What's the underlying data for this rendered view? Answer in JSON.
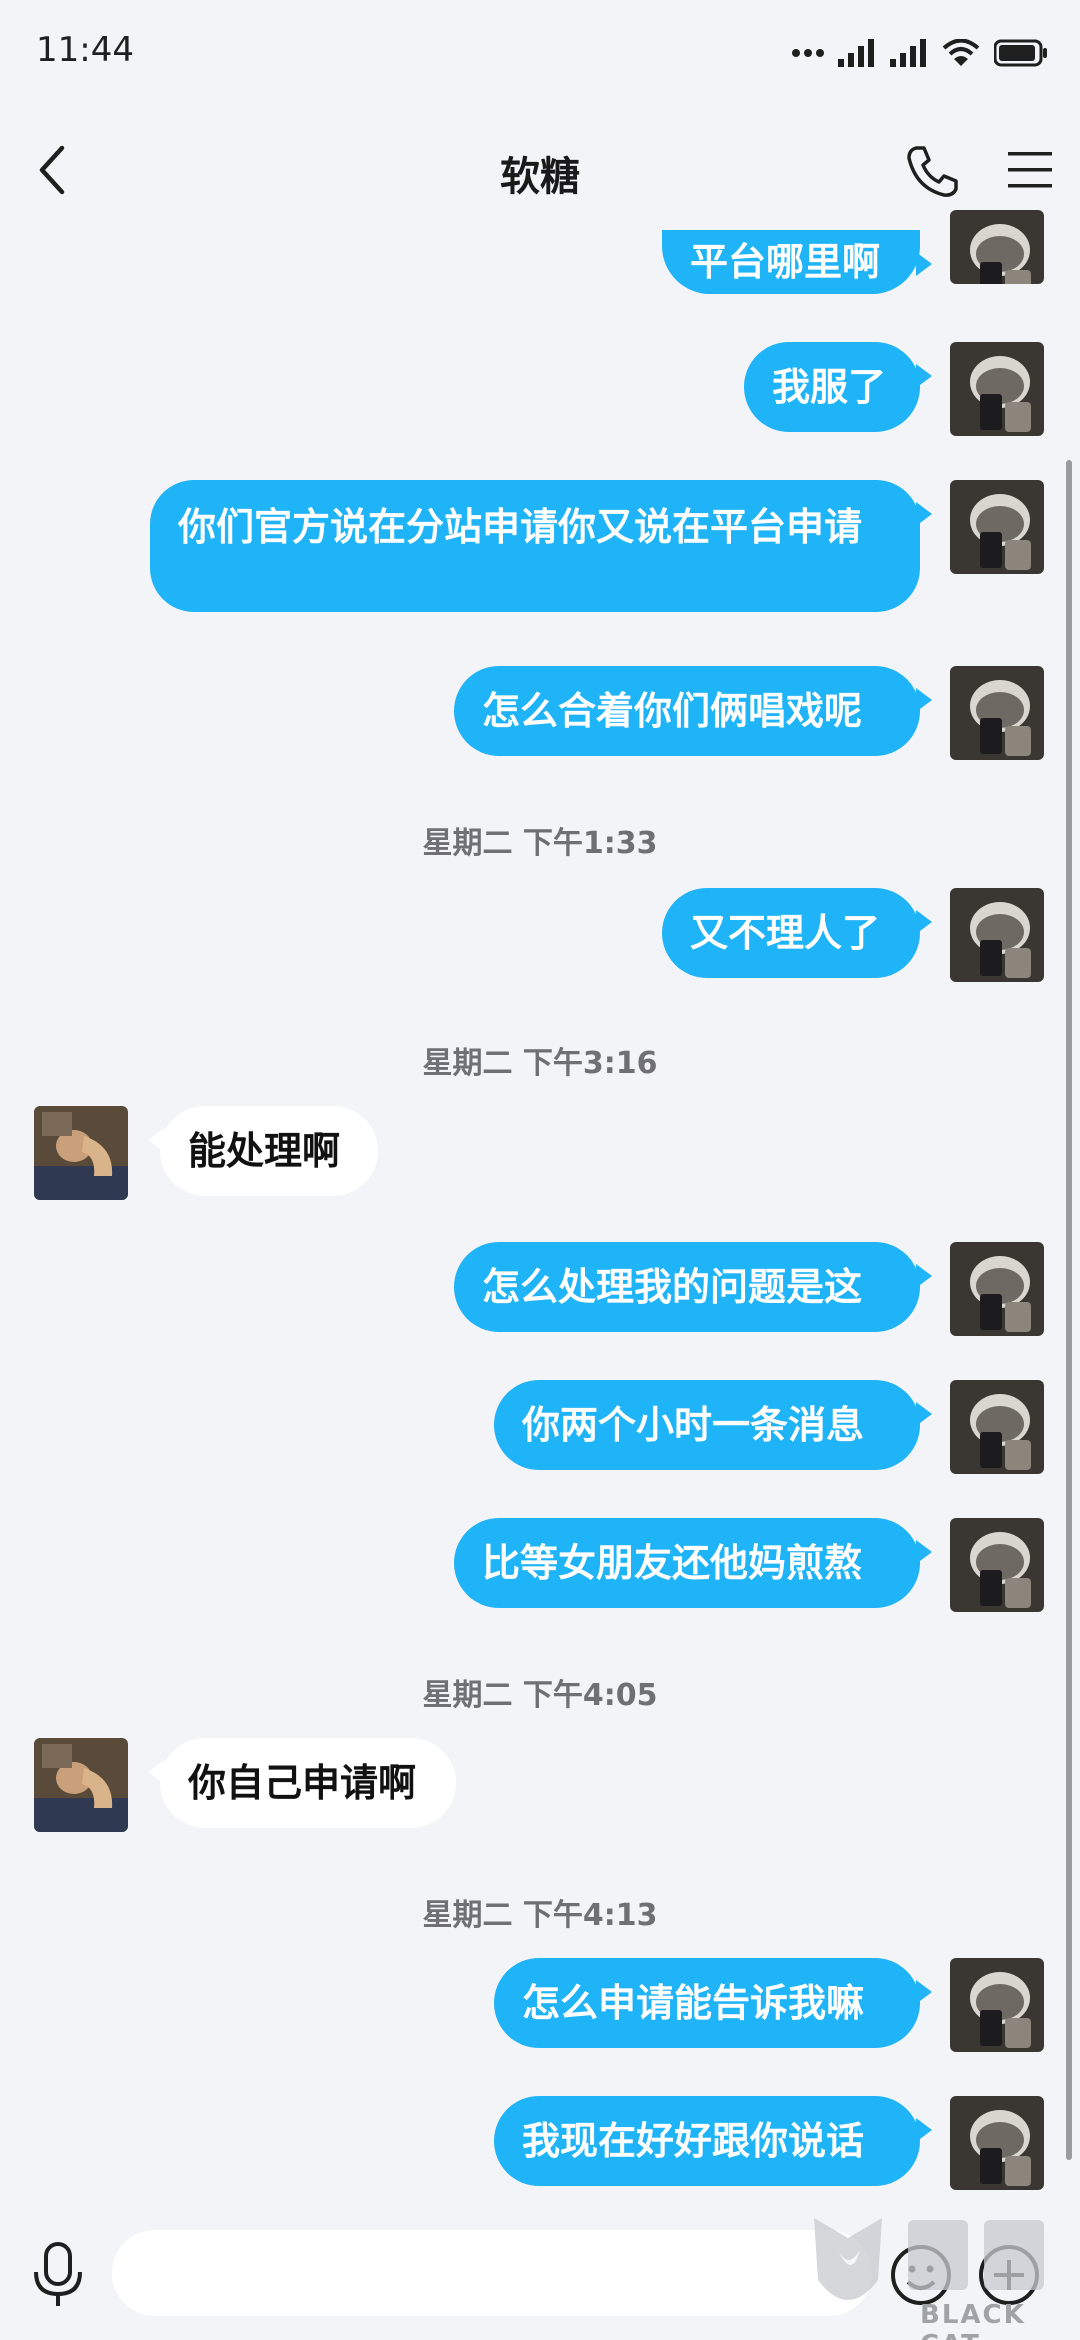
{
  "status_bar": {
    "time": "11:44"
  },
  "header": {
    "title": "软糖"
  },
  "messages": [
    {
      "type": "out",
      "text": "平台哪里啊"
    },
    {
      "type": "out",
      "text": "我服了"
    },
    {
      "type": "out",
      "text": "你们官方说在分站申请你又说在平台申请"
    },
    {
      "type": "out",
      "text": "怎么合着你们俩唱戏呢"
    },
    {
      "type": "time",
      "text": "星期二 下午1:33"
    },
    {
      "type": "out",
      "text": "又不理人了"
    },
    {
      "type": "time",
      "text": "星期二 下午3:16"
    },
    {
      "type": "in",
      "text": "能处理啊"
    },
    {
      "type": "out",
      "text": "怎么处理我的问题是这"
    },
    {
      "type": "out",
      "text": "你两个小时一条消息"
    },
    {
      "type": "out",
      "text": "比等女朋友还他妈煎熬"
    },
    {
      "type": "time",
      "text": "星期二 下午4:05"
    },
    {
      "type": "in",
      "text": "你自己申请啊"
    },
    {
      "type": "time",
      "text": "星期二 下午4:13"
    },
    {
      "type": "out",
      "text": "怎么申请能告诉我嘛"
    },
    {
      "type": "out",
      "text": "我现在好好跟你说话"
    }
  ],
  "input": {
    "value": "",
    "placeholder": ""
  },
  "icons": {
    "back": "chevron-left-icon",
    "call": "phone-icon",
    "menu": "menu-icon",
    "voice": "microphone-icon",
    "emoji": "emoji-icon",
    "more": "plus-icon"
  },
  "colors": {
    "outgoing_bubble": "#1fb3f7",
    "incoming_bubble": "#ffffff",
    "background": "#f3f4f8"
  },
  "watermark": {
    "text": "BLACK CAT"
  }
}
